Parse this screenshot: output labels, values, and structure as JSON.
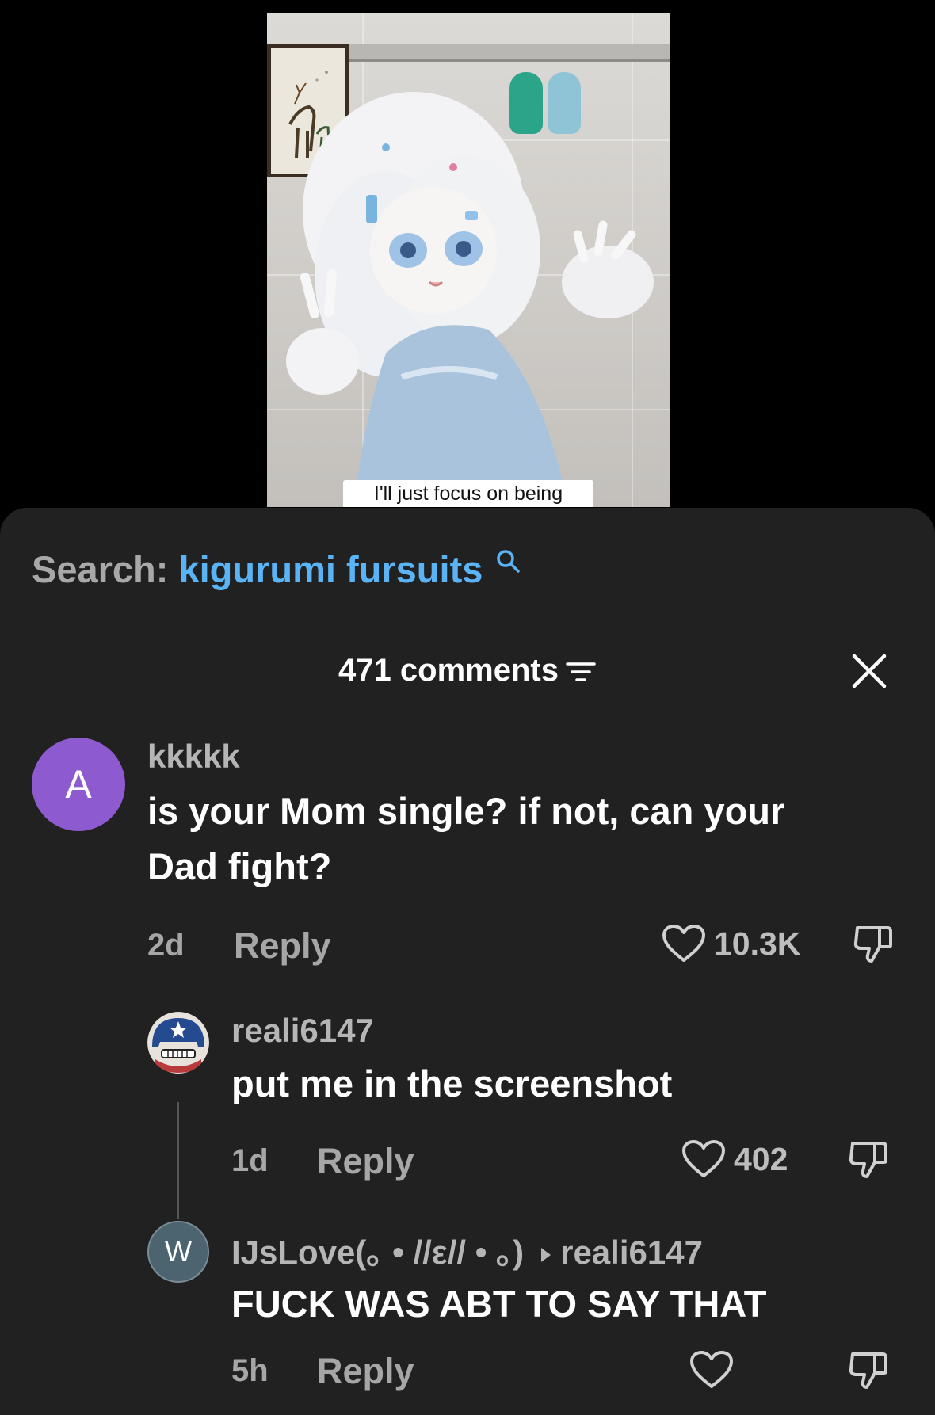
{
  "video": {
    "caption": "I'll just focus on being"
  },
  "search": {
    "prefix": "Search:",
    "term": "kigurumi fursuits",
    "icon": "search-icon",
    "term_color": "#5ab3f5"
  },
  "header": {
    "comment_count_label": "471 comments",
    "filter_icon": "filter-icon",
    "close_icon": "close-icon"
  },
  "comments": [
    {
      "avatar_letter": "A",
      "avatar_color": "#8e5ad0",
      "username": "kkkkk",
      "text_line1": "is your Mom single? if not, can your",
      "text_line2": "Dad fight?",
      "time": "2d",
      "reply_label": "Reply",
      "like_count": "10.3K"
    },
    {
      "avatar_icon": "captain-avatar",
      "username": "reali6147",
      "text": "put me in the screenshot",
      "time": "1d",
      "reply_label": "Reply",
      "like_count": "402"
    },
    {
      "avatar_letter": "W",
      "avatar_color": "#4c6470",
      "username": "IJsLove(｡ • //ε// • ｡)",
      "reply_to": "reali6147",
      "text": "FUCK WAS ABT TO SAY THAT",
      "time": "5h",
      "reply_label": "Reply",
      "like_count": ""
    }
  ]
}
